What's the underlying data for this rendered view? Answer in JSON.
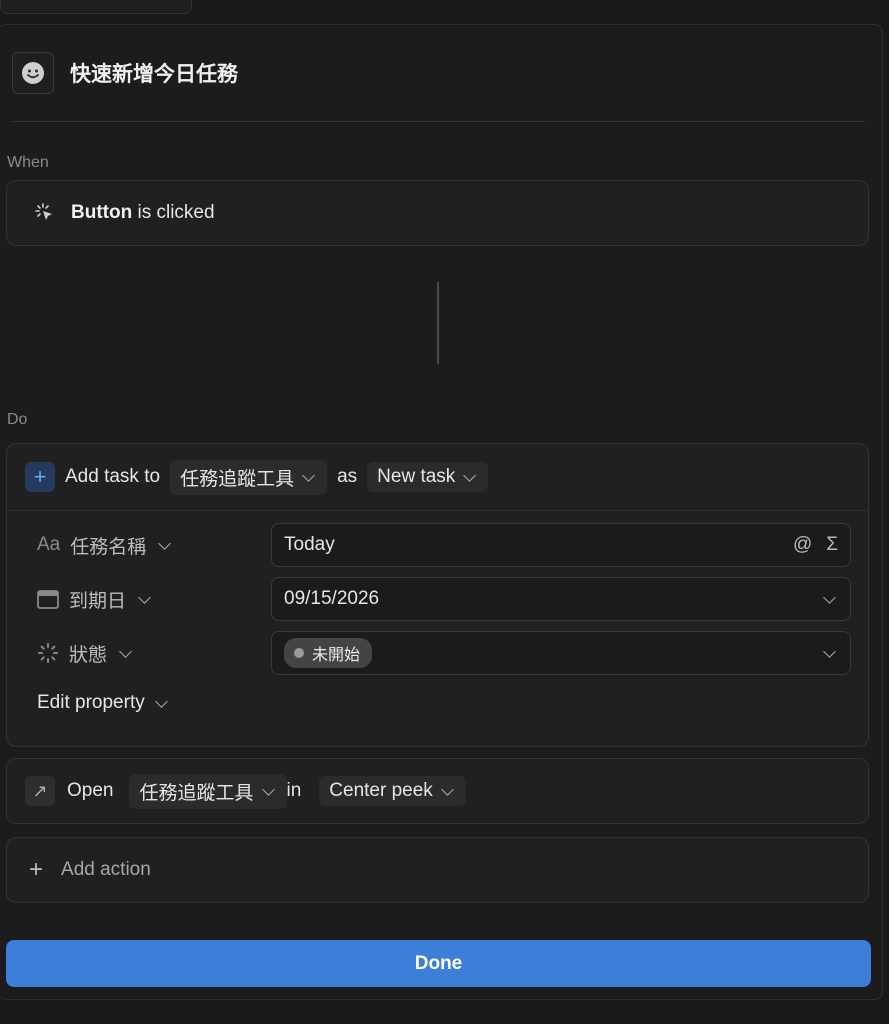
{
  "page": {
    "title": "快速新增今日任務",
    "emoji_icon": "smiley-icon"
  },
  "when": {
    "section_label": "When",
    "trigger_bold": "Button",
    "trigger_rest": "is clicked"
  },
  "do": {
    "section_label": "Do",
    "add_task": {
      "prefix": "Add task to",
      "database": "任務追蹤工具",
      "as_label": "as",
      "template": "New task",
      "properties": [
        {
          "label": "任務名稱",
          "value": "Today",
          "icon": "text-aa-icon"
        },
        {
          "label": "到期日",
          "value": "09/15/2026",
          "icon": "calendar-icon"
        },
        {
          "label": "狀態",
          "value": "未開始",
          "icon": "status-spinner-icon"
        }
      ],
      "edit_property": "Edit property"
    },
    "open": {
      "label": "Open",
      "database": "任務追蹤工具",
      "in_label": "in",
      "mode": "Center peek"
    },
    "add_action": "Add action"
  },
  "done_button": "Done",
  "colors": {
    "accent": "#3d7fd8",
    "background": "#191919",
    "card": "#202020"
  }
}
